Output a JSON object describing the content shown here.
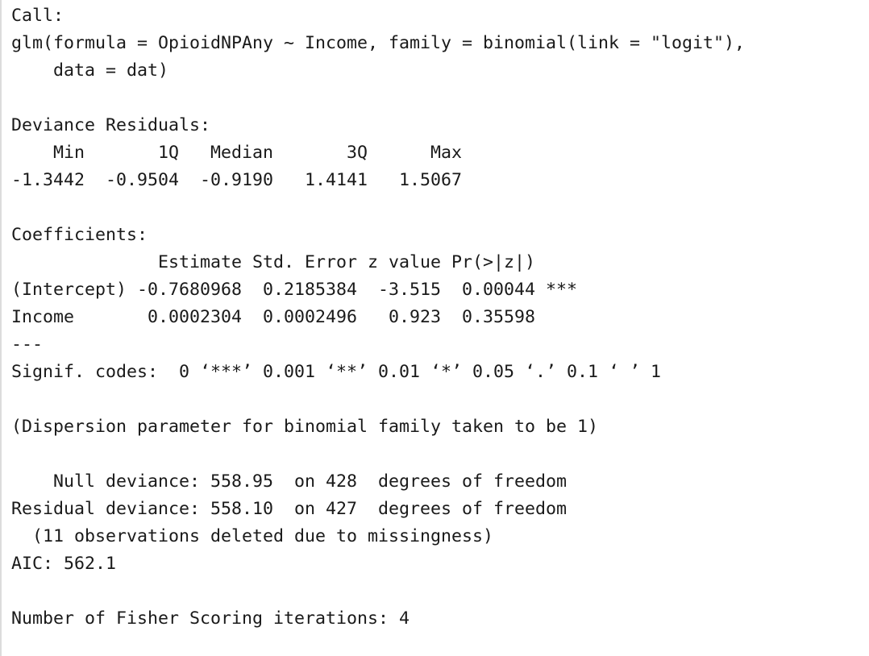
{
  "console": {
    "lines": [
      "Call:",
      "glm(formula = OpioidNPAny ~ Income, family = binomial(link = \"logit\"),",
      "    data = dat)",
      "",
      "Deviance Residuals:",
      "    Min       1Q   Median       3Q      Max",
      "-1.3442  -0.9504  -0.9190   1.4141   1.5067",
      "",
      "Coefficients:",
      "              Estimate Std. Error z value Pr(>|z|)",
      "(Intercept) -0.7680968  0.2185384  -3.515  0.00044 ***",
      "Income       0.0002304  0.0002496   0.923  0.35598",
      "---",
      "Signif. codes:  0 ‘***’ 0.001 ‘**’ 0.01 ‘*’ 0.05 ‘.’ 0.1 ‘ ’ 1",
      "",
      "(Dispersion parameter for binomial family taken to be 1)",
      "",
      "    Null deviance: 558.95  on 428  degrees of freedom",
      "Residual deviance: 558.10  on 427  degrees of freedom",
      "  (11 observations deleted due to missingness)",
      "AIC: 562.1",
      "",
      "Number of Fisher Scoring iterations: 4"
    ]
  }
}
